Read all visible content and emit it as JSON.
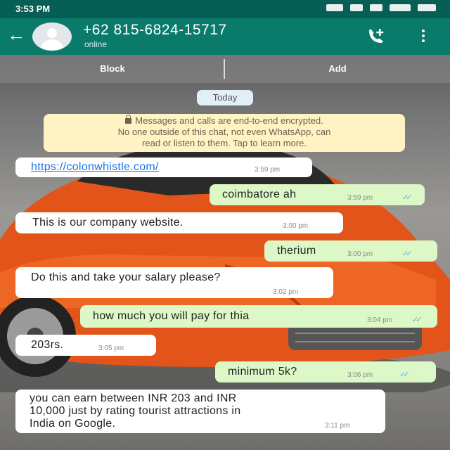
{
  "status_bar": {
    "time": "3:53 PM"
  },
  "header": {
    "back_icon": "arrow-left-icon",
    "contact_name": "+62 815-6824-15717",
    "presence": "online",
    "call_icon": "add-call-icon",
    "menu_icon": "more-vertical-icon",
    "color": "#0a7a6b"
  },
  "actions": {
    "block_label": "Block",
    "add_label": "Add"
  },
  "date_chip": "Today",
  "encryption_notice": {
    "line1": "Messages and calls are end-to-end encrypted.",
    "line2": "No one outside of this chat, not even WhatsApp, can",
    "line3": "read or listen to them. Tap to learn more."
  },
  "messages": [
    {
      "direction": "in",
      "text": "https://colonwhistle.com/",
      "time": "3:59 pm"
    },
    {
      "direction": "out",
      "text": "coimbatore ah",
      "time": "3:59 pm"
    },
    {
      "direction": "in",
      "text": "This is our company website.",
      "time": "3:00 pm"
    },
    {
      "direction": "out",
      "text": "therium",
      "time": "3:00 pm"
    },
    {
      "direction": "in",
      "text": "Do this and take your salary please?",
      "time": "3:02 pm"
    },
    {
      "direction": "out",
      "text": "how much you will pay for thia",
      "time": "3:04 pm"
    },
    {
      "direction": "in",
      "text": "203rs.",
      "time": "3:05 pm"
    },
    {
      "direction": "out",
      "text": "minimum 5k?",
      "time": "3:06 pm"
    },
    {
      "direction": "in",
      "line1": "you can earn between INR 203 and INR",
      "line2": "10,000 just by rating tourist attractions in",
      "line3": "India on Google.",
      "time": "3:11 pm"
    }
  ]
}
